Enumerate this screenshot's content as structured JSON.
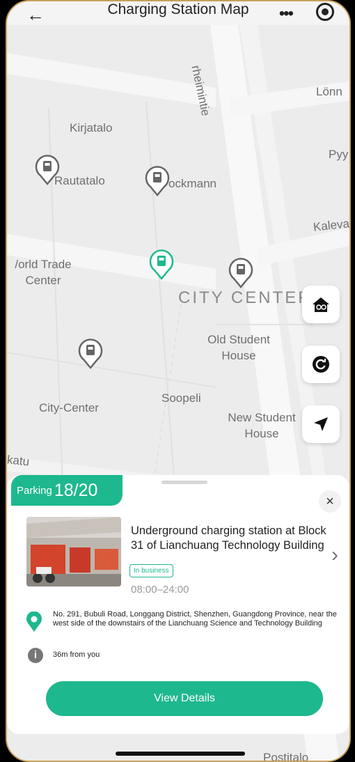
{
  "header": {
    "title": "Charging Station Map",
    "more_icon": "more-dots-icon",
    "locate_icon": "target-icon",
    "back_icon": "back-arrow-icon"
  },
  "map": {
    "places": {
      "lonn": "Lönn",
      "rheinintie": "rheimintie",
      "kirjatalo": "Kirjatalo",
      "pyy": "Pyy",
      "rautatalo": "Rautatalo",
      "stockmann": "ockmann",
      "kaleva": "Kaleva",
      "world_trade_1": "/orld Trade",
      "world_trade_2": "Center",
      "city_center": "CITY CENTEF",
      "old_student_1": "Old Student",
      "old_student_2": "House",
      "soopeli": "Soopeli",
      "new_student_1": "New Student",
      "new_student_2": "House",
      "city_center2": "City-Center",
      "katu": "katu",
      "postitalo": "Postitalo"
    }
  },
  "sheet": {
    "parking_label": "Parking",
    "parking_count": "18/20",
    "station_name": "Underground charging station at Block 31 of Lianchuang Technology Building",
    "status": "In business",
    "hours": "08:00–24:00",
    "address": "No. 291, Bubuli Road, Longgang District, Shenzhen, Guangdong Province, near the west side of the downstairs of the Lianchuang Science and Technology Building",
    "distance": "36m from you",
    "view_details": "View Details",
    "close_symbol": "×",
    "chevron_symbol": "›"
  },
  "colors": {
    "accent": "#1eb88e",
    "pin_gray": "#666666"
  }
}
